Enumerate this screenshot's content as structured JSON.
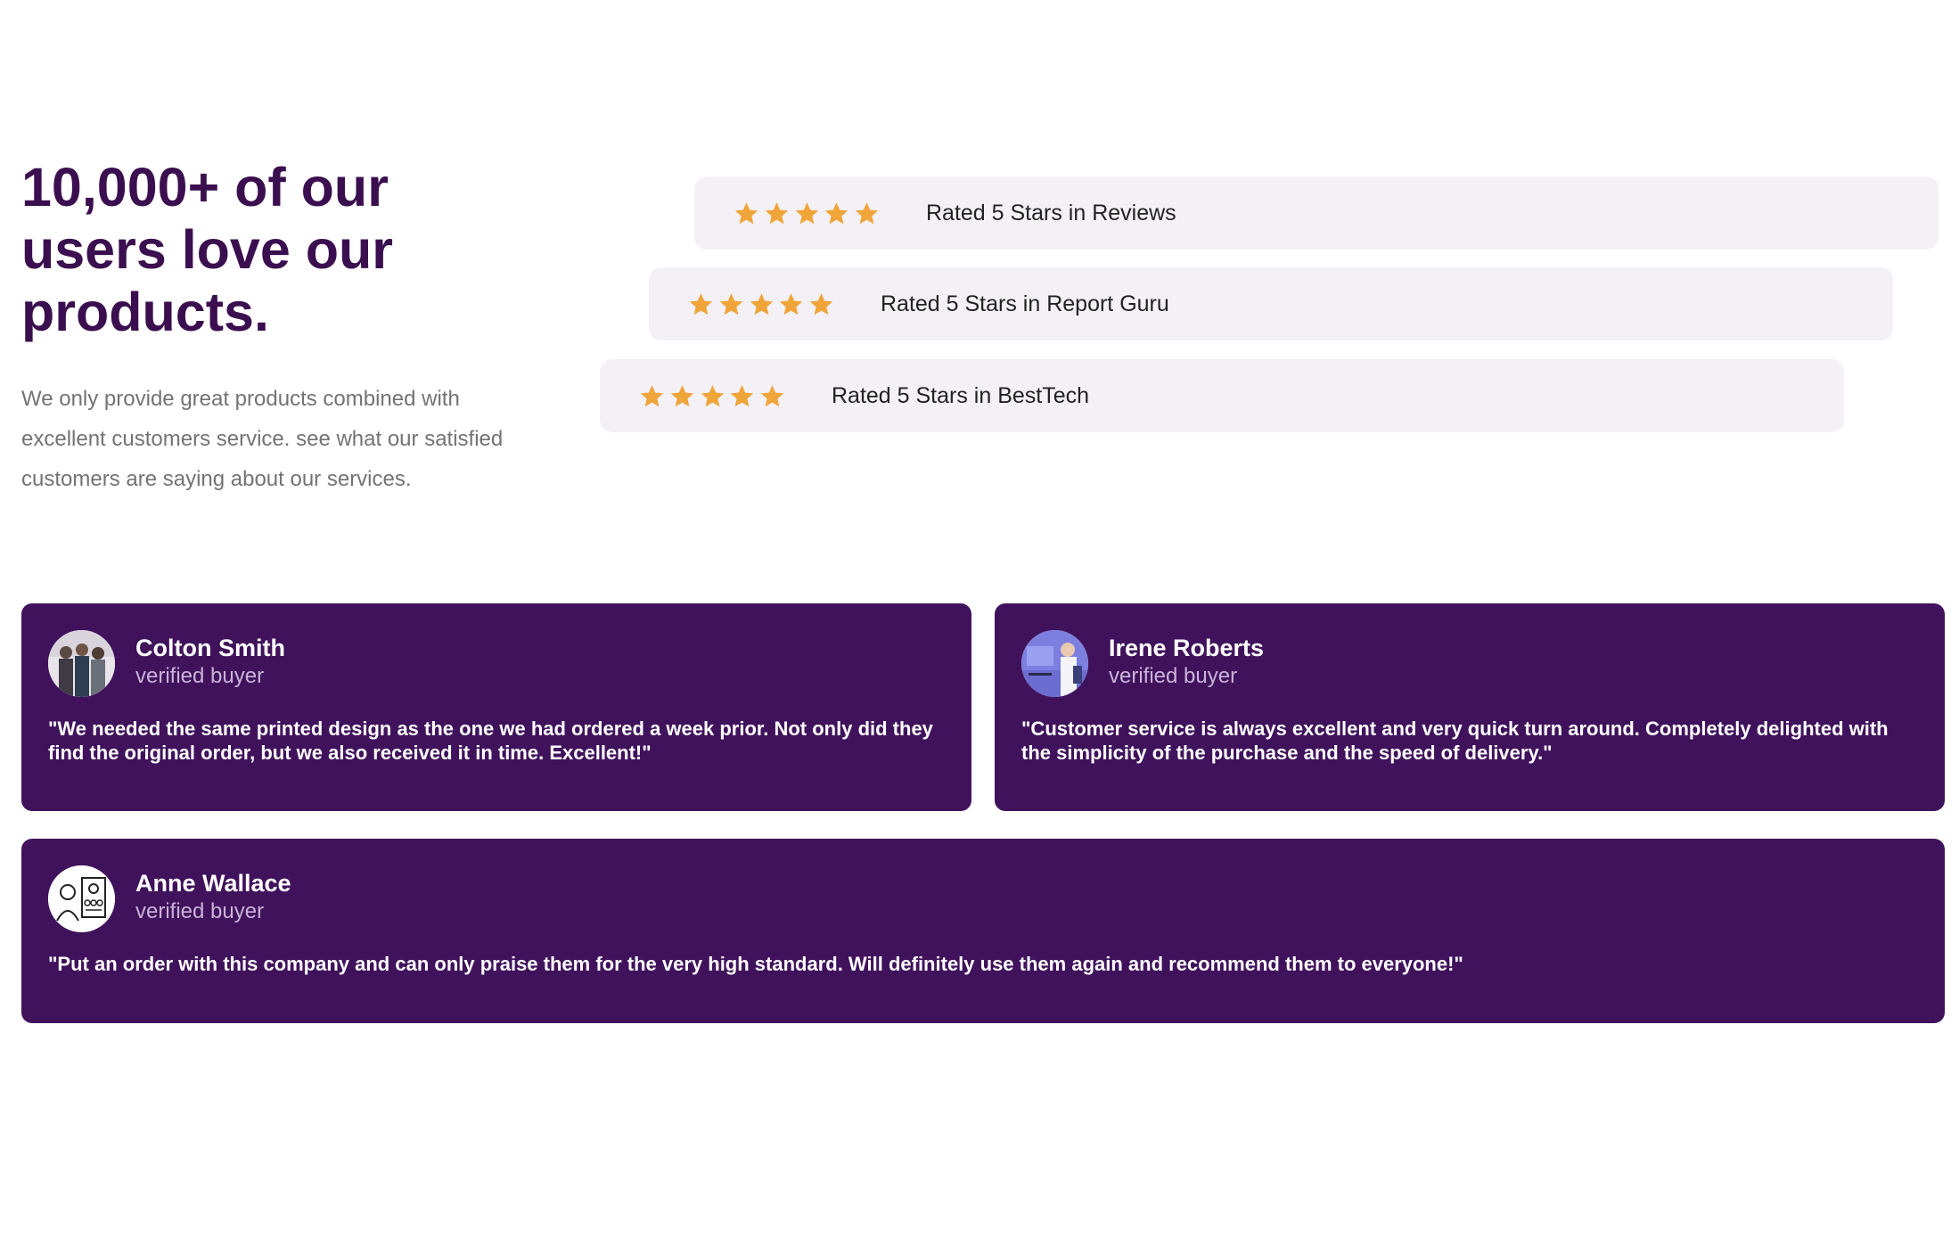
{
  "hero": {
    "title": "10,000+ of our users love our products.",
    "description": "We only provide great products combined with excellent customers service. see what our satisfied customers are saying about our services."
  },
  "ratings": [
    {
      "stars": 5,
      "label": "Rated 5 Stars in Reviews"
    },
    {
      "stars": 5,
      "label": "Rated 5 Stars in Report Guru"
    },
    {
      "stars": 5,
      "label": "Rated 5 Stars in BestTech"
    }
  ],
  "reviews": [
    {
      "name": "Colton Smith",
      "role": "verified buyer",
      "text": "\"We needed the same printed design as the one we had ordered a week prior. Not only did they find the original order, but we also received it in time. Excellent!\""
    },
    {
      "name": "Irene Roberts",
      "role": "verified buyer",
      "text": "\"Customer service is always excellent and very quick turn around. Completely delighted with the simplicity of the purchase and the speed of delivery.\""
    },
    {
      "name": "Anne Wallace",
      "role": "verified buyer",
      "text": "\"Put an order with this company and can only praise them for the very high standard. Will definitely use them again and recommend them to everyone!\""
    }
  ],
  "colors": {
    "heading": "#3b0f4f",
    "card_background": "#40125c",
    "rating_background": "#f3f1f6",
    "star": "#f0a53a",
    "muted_text": "#737373"
  },
  "icons": {
    "star": "star-icon",
    "avatar": "avatar-photo"
  }
}
